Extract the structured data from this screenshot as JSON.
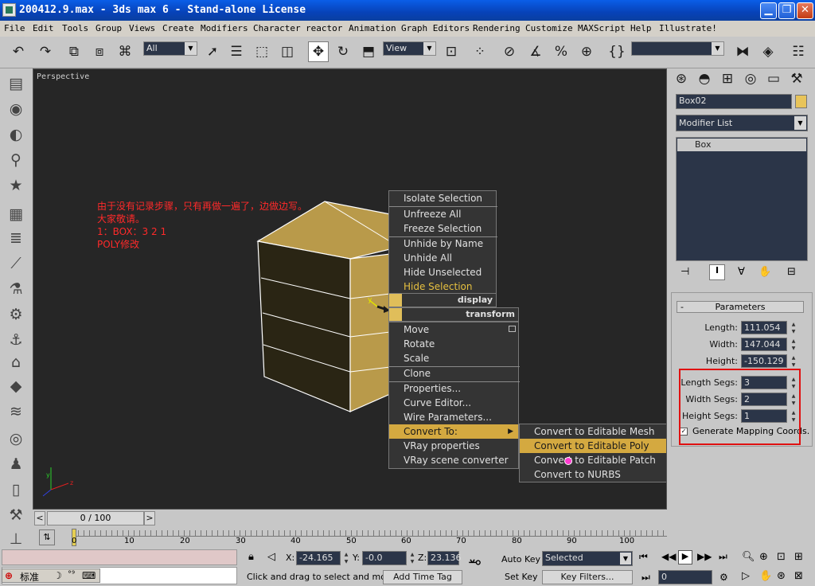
{
  "window": {
    "title": "200412.9.max - 3ds max 6 - Stand-alone License"
  },
  "menu": [
    "File",
    "Edit",
    "Tools",
    "Group",
    "Views",
    "Create",
    "Modifiers",
    "Character",
    "reactor",
    "Animation",
    "Graph Editors",
    "Rendering",
    "Customize",
    "MAXScript",
    "Help",
    "Illustrate!"
  ],
  "toolbar": {
    "filter": "All",
    "ref_coord": "View",
    "named_sel": ""
  },
  "viewport": {
    "label": "Perspective",
    "note": [
      "由于没有记录步骤，只有再做一遍了，边做边写。",
      "大家敬请。",
      "1：BOX：3 2 1",
      "POLY修改"
    ]
  },
  "quad": {
    "display_items": [
      "Isolate Selection",
      "Unfreeze All",
      "Freeze Selection",
      "Unhide by Name",
      "Unhide All",
      "Hide Unselected",
      "Hide Selection"
    ],
    "display_title": "display",
    "transform_title": "transform",
    "transform_items": [
      "Move",
      "Rotate",
      "Scale",
      "Clone",
      "Properties...",
      "Curve Editor...",
      "Wire Parameters...",
      "Convert To:",
      "VRay properties",
      "VRay scene converter"
    ],
    "submenu": [
      "Convert to Editable Mesh",
      "Convert to Editable Poly",
      "Convert to Editable Patch",
      "Convert to NURBS"
    ]
  },
  "panel": {
    "object_name": "Box02",
    "object_color": "#e8c45a",
    "modifier_list": "Modifier List",
    "stack": [
      "Box"
    ],
    "rollout": "Parameters",
    "params": [
      {
        "label": "Length:",
        "value": "111.054"
      },
      {
        "label": "Width:",
        "value": "147.044"
      },
      {
        "label": "Height:",
        "value": "-150.129"
      },
      {
        "label": "Length Segs:",
        "value": "3"
      },
      {
        "label": "Width Segs:",
        "value": "2"
      },
      {
        "label": "Height Segs:",
        "value": "1"
      }
    ],
    "checkbox": "Generate Mapping Coords."
  },
  "timeline": {
    "slider": "0 / 100",
    "ticks": [
      "0",
      "10",
      "20",
      "30",
      "40",
      "50",
      "60",
      "70",
      "80",
      "90",
      "100"
    ]
  },
  "status": {
    "x_label": "X:",
    "x": "-24.165",
    "y_label": "Y:",
    "y": "-0.0",
    "z_label": "Z:",
    "z": "23.136",
    "prompt": "Click and drag to select and move",
    "add_time_tag": "Add Time Tag",
    "auto_key": "Auto Key",
    "set_key": "Set Key",
    "key_mode": "Selected",
    "key_filters": "Key Filters...",
    "frame": "0"
  },
  "ime": {
    "label": "标准"
  }
}
